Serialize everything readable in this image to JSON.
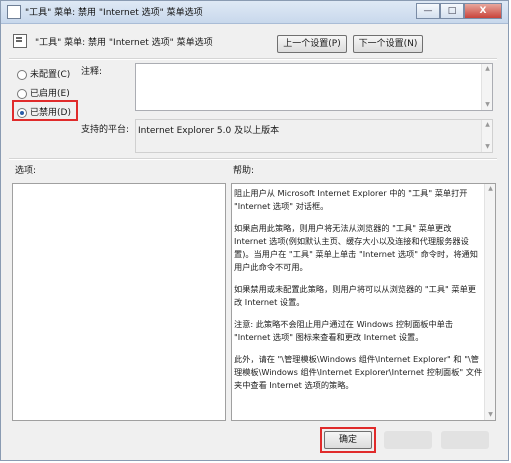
{
  "window": {
    "title": "\"工具\" 菜单: 禁用 \"Internet 选项\" 菜单选项",
    "min_glyph": "—",
    "max_glyph": "□",
    "close_glyph": "X"
  },
  "header": {
    "policy_name": "\"工具\" 菜单: 禁用 \"Internet 选项\" 菜单选项",
    "prev_button": "上一个设置(P)",
    "next_button": "下一个设置(N)"
  },
  "state": {
    "options": [
      {
        "label": "未配置(C)",
        "selected": false
      },
      {
        "label": "已启用(E)",
        "selected": false
      },
      {
        "label": "已禁用(D)",
        "selected": true
      }
    ]
  },
  "comment": {
    "label": "注释:",
    "value": ""
  },
  "platform": {
    "label": "支持的平台:",
    "value": "Internet Explorer 5.0 及以上版本"
  },
  "options_label": "选项:",
  "help": {
    "label": "帮助:",
    "paragraphs": [
      "阻止用户从 Microsoft Internet Explorer 中的 \"工具\" 菜单打开 \"Internet 选项\" 对话框。",
      "如果启用此策略，则用户将无法从浏览器的 \"工具\" 菜单更改 Internet 选项(例如默认主页、缓存大小以及连接和代理服务器设置)。当用户在 \"工具\" 菜单上单击 \"Internet 选项\" 命令时，将通知用户此命令不可用。",
      "如果禁用或未配置此策略，则用户将可以从浏览器的 \"工具\" 菜单更改 Internet 设置。",
      "注意: 此策略不会阻止用户通过在 Windows 控制面板中单击 \"Internet 选项\" 图标来查看和更改 Internet 设置。",
      "此外，请在 \"\\管理模板\\Windows 组件\\Internet Explorer\" 和 \"\\管理模板\\Windows 组件\\Internet Explorer\\Internet 控制面板\" 文件夹中查看 Internet 选项的策略。"
    ]
  },
  "footer": {
    "ok_button": "确定"
  },
  "colors": {
    "highlight_box": "#e02b2b",
    "window_bg": "#f0f0f0"
  }
}
